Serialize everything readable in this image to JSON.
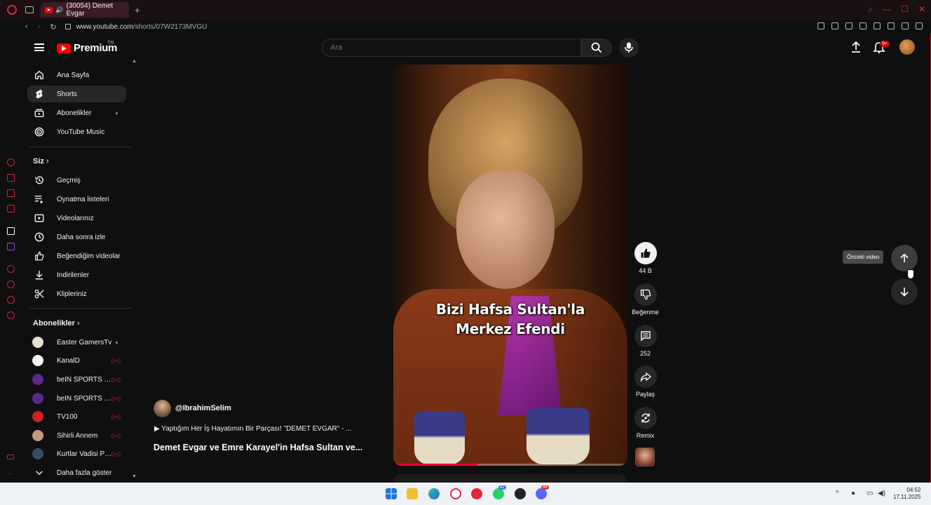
{
  "browser": {
    "tab_title": "(30054) Demet Evgar",
    "url_host": "www.youtube.com",
    "url_path": "/shorts/07W2173MVGU",
    "new_tab": "+"
  },
  "header": {
    "logo_text": "Premium",
    "country_code": "TR",
    "search_placeholder": "Ara",
    "notif_badge": "9+"
  },
  "sidebar": {
    "main": [
      {
        "label": "Ana Sayfa",
        "icon": "home-icon"
      },
      {
        "label": "Shorts",
        "icon": "shorts-icon",
        "active": true
      },
      {
        "label": "Abonelikler",
        "icon": "subscriptions-icon"
      },
      {
        "label": "YouTube Music",
        "icon": "music-icon"
      }
    ],
    "you_title": "Siz",
    "you": [
      {
        "label": "Geçmiş",
        "icon": "history-icon"
      },
      {
        "label": "Oynatma listeleri",
        "icon": "playlists-icon"
      },
      {
        "label": "Videolarınız",
        "icon": "your-videos-icon"
      },
      {
        "label": "Daha sonra izle",
        "icon": "watch-later-icon"
      },
      {
        "label": "Beğendiğim videolar",
        "icon": "liked-icon"
      },
      {
        "label": "İndirilenler",
        "icon": "download-icon"
      },
      {
        "label": "Klipleriniz",
        "icon": "clips-icon"
      }
    ],
    "subs_title": "Abonelikler",
    "subs": [
      {
        "label": "Easter GamersTv",
        "status": "dot",
        "color": "#e6e0d0"
      },
      {
        "label": "KanalD",
        "status": "live",
        "color": "#f4f4f4"
      },
      {
        "label": "beIN SPORTS Tü...",
        "status": "live",
        "color": "#5a2a8a"
      },
      {
        "label": "beIN SPORTS Ar...",
        "status": "live",
        "color": "#5a2a8a"
      },
      {
        "label": "TV100",
        "status": "live",
        "color": "#d21f1f"
      },
      {
        "label": "Sihirli Annem",
        "status": "live",
        "color": "#c49a7a"
      },
      {
        "label": "Kurtlar Vadisi Pu...",
        "status": "live",
        "color": "#3a4a6a"
      }
    ],
    "show_more": "Daha fazla göster"
  },
  "video": {
    "caption_line1": "Bizi Hafsa Sultan'la",
    "caption_line2": "Merkez Efendi",
    "progress": 0.36,
    "channel": "@IbrahimSelim",
    "music": "▶ Yaptığım Her İş Hayatımın Bir Parçası! \"DEMET EVGAR\" - ...",
    "title": "Demet Evgar ve Emre Karayel'in Hafsa Sultan ve..."
  },
  "actions": {
    "like_count": "44 B",
    "dislike_label": "Beğenme",
    "comment_count": "252",
    "share_label": "Paylaş",
    "remix_label": "Remix"
  },
  "navigation": {
    "tooltip": "Önceki video"
  },
  "taskbar": {
    "whatsapp_badge": "82",
    "discord_badge": "99",
    "time": "04:52",
    "date": "17.11.2025"
  }
}
